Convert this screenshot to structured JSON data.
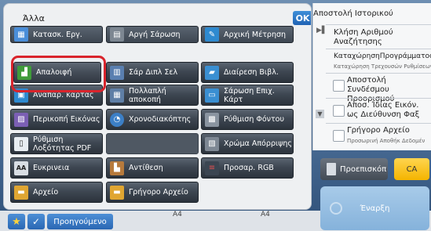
{
  "panel": {
    "title": "Άλλα",
    "ok_label": "OK"
  },
  "tiles": [
    {
      "label": "Κατασκ. Εργ.",
      "icon": "job-build-icon"
    },
    {
      "label": "Αργή Σάρωση",
      "icon": "slow-scan-icon"
    },
    {
      "label": "Αρχική Μέτρηση",
      "icon": "original-count-icon"
    },
    {
      "label": "Απαλοιφή",
      "icon": "erase-icon"
    },
    {
      "label": "Σάρ Διπλ Σελ",
      "icon": "dual-page-scan-icon"
    },
    {
      "label": "Διαίρεση Βιβλ.",
      "icon": "book-divide-icon"
    },
    {
      "label": "Αναπαρ. κάρτας",
      "icon": "card-shot-icon"
    },
    {
      "label": "Πολλαπλή αποκοπή",
      "icon": "multi-crop-icon"
    },
    {
      "label": "Σάρωση Επιχ. Κάρτ",
      "icon": "business-card-scan-icon"
    },
    {
      "label": "Περικοπή Εικόνας",
      "icon": "image-crop-icon"
    },
    {
      "label": "Χρονοδιακόπτης",
      "icon": "timer-icon"
    },
    {
      "label": "Ρύθμιση Φόντου",
      "icon": "background-adjust-icon"
    },
    {
      "label": "Ρύθμιση Λοξότητας PDF",
      "icon": "pdf-skew-icon"
    },
    {
      "label": "Χρώμα Απόρριψης",
      "icon": "color-drop-icon"
    },
    {
      "label": "Ευκρινεια",
      "icon": "sharpness-icon"
    },
    {
      "label": "Αντίθεση",
      "icon": "contrast-icon"
    },
    {
      "label": "Προσαρ. RGB",
      "icon": "rgb-adjust-icon"
    },
    {
      "label": "Αρχείο",
      "icon": "file-icon"
    },
    {
      "label": "Γρήγορο Αρχείο",
      "icon": "quick-file-icon"
    }
  ],
  "bottom": {
    "prev_label": "Προηγούμενο",
    "paper_1": "A4",
    "paper_2": "A4"
  },
  "right": {
    "title": "Αποστολή Ιστορικού",
    "recall_label": "Κλήση Αριθμού Αναζήτησης",
    "program_label": "ΚαταχώρησηΠρογράμματος",
    "program_sub": "Καταχώρηση Τρεχουσών Ρυθμίσεων",
    "send_link": "Αποστολή Συνδέσμου Προορισμού",
    "same_image": "Αποσ. Ίδιας Εικόν. ως Διεύθυνση Φαξ",
    "quick_file": "Γρήγορο Αρχείο",
    "quick_file_sub": "Προσωρινή Αποθήκ Δεδομέν",
    "preview_label": "Προεπισκόπ",
    "ca_label": "CA",
    "start_label": "Έναρξη"
  },
  "colors": {
    "highlight": "#d9242c",
    "accent": "#2a67b3",
    "ca": "#f4b400"
  }
}
